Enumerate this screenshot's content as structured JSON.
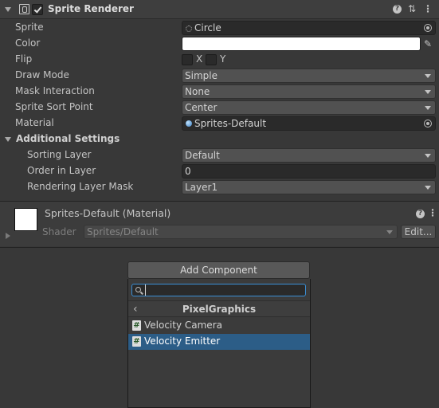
{
  "component": {
    "title": "Sprite Renderer",
    "enabled": true,
    "icons": [
      "foldout-arrow-icon",
      "sprite-renderer-icon",
      "help-icon",
      "presets-icon",
      "more-icon"
    ]
  },
  "fields": {
    "sprite": {
      "label": "Sprite",
      "value": "Circle"
    },
    "color": {
      "label": "Color",
      "value": "#ffffff"
    },
    "flip": {
      "label": "Flip",
      "x_label": "X",
      "y_label": "Y",
      "x": false,
      "y": false
    },
    "draw_mode": {
      "label": "Draw Mode",
      "value": "Simple"
    },
    "mask_interaction": {
      "label": "Mask Interaction",
      "value": "None"
    },
    "sprite_sort_point": {
      "label": "Sprite Sort Point",
      "value": "Center"
    },
    "material": {
      "label": "Material",
      "value": "Sprites-Default"
    }
  },
  "additional": {
    "label": "Additional Settings",
    "sorting_layer": {
      "label": "Sorting Layer",
      "value": "Default"
    },
    "order_in_layer": {
      "label": "Order in Layer",
      "value": "0"
    },
    "rendering_layer_mask": {
      "label": "Rendering Layer Mask",
      "value": "Layer1"
    }
  },
  "material_panel": {
    "title": "Sprites-Default (Material)",
    "shader_label": "Shader",
    "shader_value": "Sprites/Default",
    "edit_label": "Edit..."
  },
  "add_component": {
    "button_label": "Add Component",
    "search_value": "",
    "category": "PixelGraphics",
    "items": [
      {
        "label": "Velocity Camera",
        "selected": false
      },
      {
        "label": "Velocity Emitter",
        "selected": true
      }
    ]
  },
  "colors": {
    "background": "#383838",
    "selection": "#2c5d87",
    "search_focus": "#3b8fd6"
  }
}
